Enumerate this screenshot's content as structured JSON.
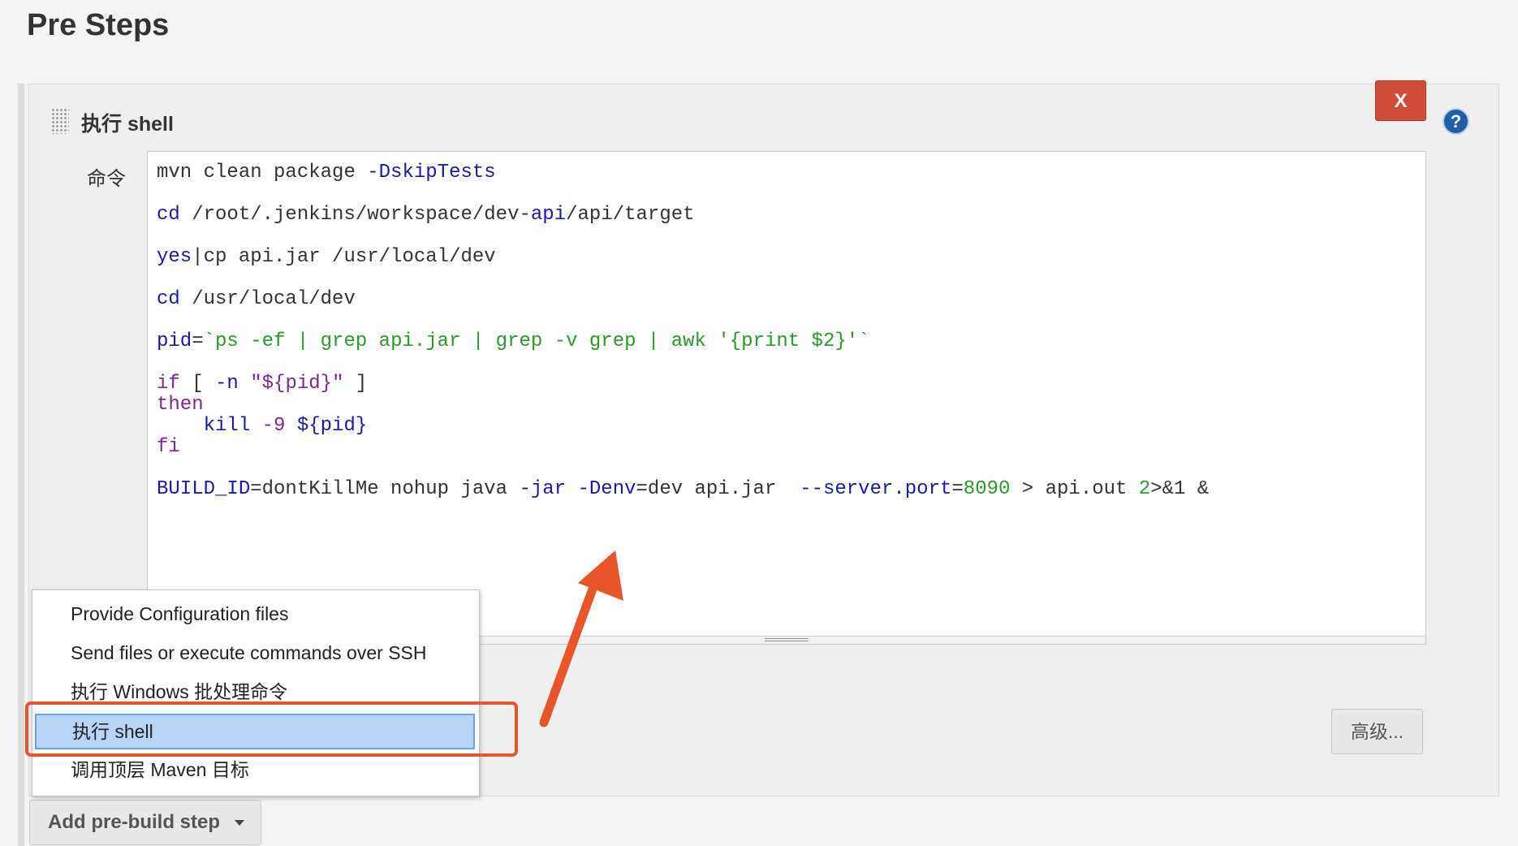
{
  "section_title": "Pre Steps",
  "step": {
    "title": "执行 shell",
    "delete_label": "X",
    "help_label": "?",
    "command_label": "命令",
    "advanced_label": "高级..."
  },
  "code": [
    [
      [
        "mvn clean package ",
        ""
      ],
      [
        "-DskipTests",
        "kw"
      ]
    ],
    [
      [
        "cd",
        "kw"
      ],
      [
        " /root/.jenkins/workspace/dev-",
        ""
      ],
      [
        "api",
        "kw"
      ],
      [
        "/api/target",
        ""
      ]
    ],
    [
      [
        "yes",
        "kw"
      ],
      [
        "|cp api.jar /usr/local/dev",
        ""
      ]
    ],
    [
      [
        "cd",
        "kw"
      ],
      [
        " /usr/local/dev",
        ""
      ]
    ],
    [
      [
        "pid",
        "kw"
      ],
      [
        "=",
        ""
      ],
      [
        "`ps -ef | grep api.jar | grep -v grep | awk '{print $2}'`",
        "str"
      ]
    ],
    [
      [
        "if",
        "ctl"
      ],
      [
        " [ ",
        ""
      ],
      [
        "-n",
        "kw"
      ],
      [
        " ",
        ""
      ],
      [
        "\"${pid}\"",
        "ctl"
      ],
      [
        " ]",
        ""
      ]
    ],
    [
      [
        "then",
        "ctl"
      ]
    ],
    [
      [
        "    kill ",
        "kw"
      ],
      [
        "-9",
        "ctl"
      ],
      [
        " ${pid}",
        "kw"
      ]
    ],
    [
      [
        "fi",
        "ctl"
      ]
    ],
    [
      [
        "BUILD_ID",
        "kw"
      ],
      [
        "=dontKillMe nohup java ",
        ""
      ],
      [
        "-jar",
        "kw"
      ],
      [
        " ",
        ""
      ],
      [
        "-Denv",
        "kw"
      ],
      [
        "=dev api.jar  ",
        ""
      ],
      [
        "--server.port",
        "kw"
      ],
      [
        "=",
        ""
      ],
      [
        "8090",
        "num"
      ],
      [
        " > api.out ",
        ""
      ],
      [
        "2",
        "num"
      ],
      [
        ">&1 &",
        ""
      ]
    ]
  ],
  "menu": {
    "items": [
      "Provide Configuration files",
      "Send files or execute commands over SSH",
      "执行 Windows 批处理命令",
      "执行 shell",
      "调用顶层 Maven 目标"
    ],
    "selected_index": 3
  },
  "add_step_label": "Add pre-build step",
  "colors": {
    "keyword": "#1a1aa6",
    "control": "#7b2a95",
    "string": "#2a9a2a",
    "delete_button": "#cf4b3a",
    "highlight": "#e8552b",
    "selection": "#b8d4f7"
  },
  "icons": [
    "drag-handle-icon",
    "help-icon",
    "caret-down-icon",
    "annotation-arrow"
  ]
}
